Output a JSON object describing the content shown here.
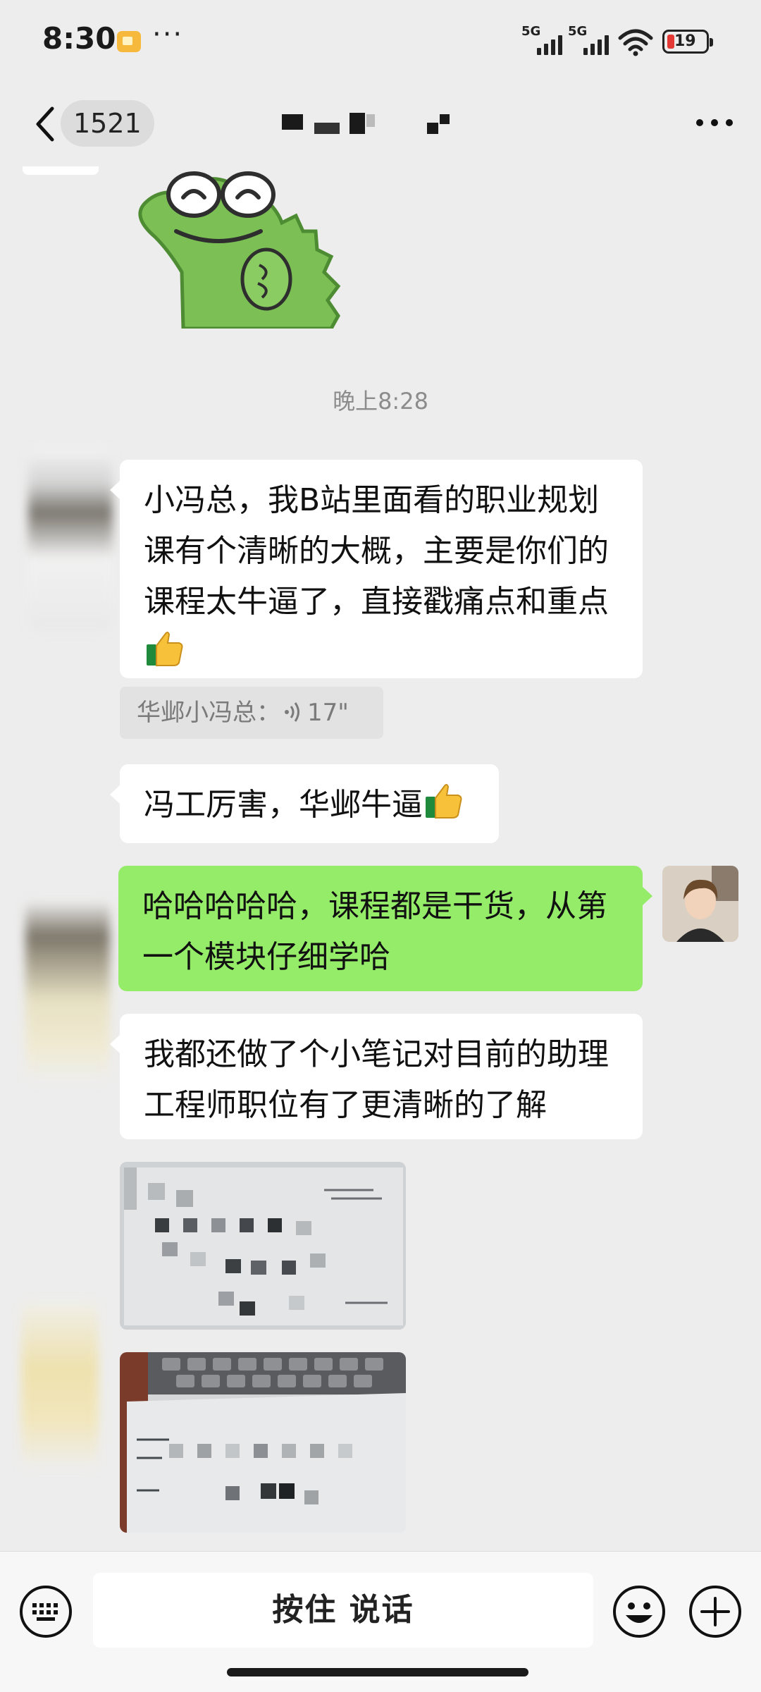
{
  "status_bar": {
    "time": "8:30",
    "more": "···",
    "signal_1_label": "5G",
    "signal_2_label": "5G",
    "battery_level": "19",
    "battery_color": "#e53935"
  },
  "nav": {
    "unread_count": "1521",
    "title_redacted": true
  },
  "chat": {
    "timestamp": "晚上8:28",
    "messages": [
      {
        "from": "other",
        "type": "sticker",
        "sticker": "green-crocodile-sticker"
      },
      {
        "from": "other",
        "type": "text",
        "lines": [
          "小冯总，我B站里面看的职业规划",
          "课有个清晰的大概，主要是你们的",
          "课程太牛逼了，直接戳痛点和重点"
        ],
        "emoji": "thumbs-up"
      },
      {
        "from": "other",
        "type": "quote",
        "quote_author": "华邺小冯总：",
        "quote_duration": "17\""
      },
      {
        "from": "other",
        "type": "text",
        "text": "冯工厉害，华邺牛逼",
        "emoji": "thumbs-up"
      },
      {
        "from": "self",
        "type": "text",
        "lines": [
          "哈哈哈哈哈，课程都是干货，从第",
          "一个模块仔细学哈"
        ]
      },
      {
        "from": "other",
        "type": "text",
        "lines": [
          "我都还做了个小笔记对目前的助理",
          "工程师职位有了更清晰的了解"
        ]
      },
      {
        "from": "other",
        "type": "image",
        "content": "handwritten-notes-photo-pixelated"
      },
      {
        "from": "other",
        "type": "image",
        "content": "notes-on-laptop-photo-pixelated"
      }
    ],
    "bubble_color_other": "#ffffff",
    "bubble_color_self": "#95ec69"
  },
  "input_bar": {
    "hold_to_talk": "按住 说话"
  }
}
